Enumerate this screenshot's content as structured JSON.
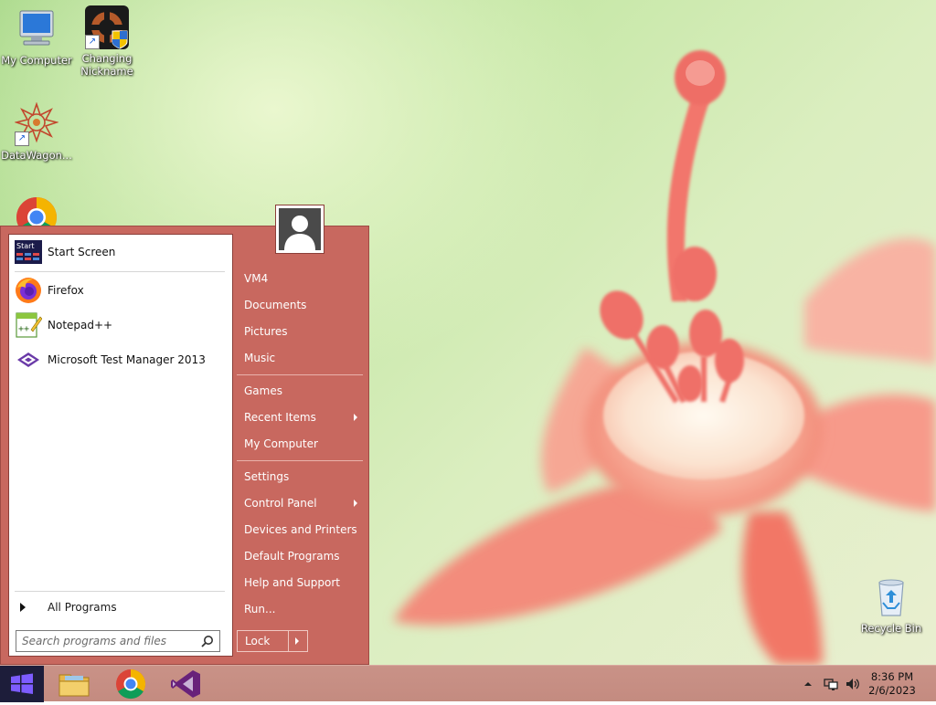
{
  "desktop": {
    "icons": [
      {
        "label": "My Computer",
        "icon": "computer-icon"
      },
      {
        "label": "Changing Nickname",
        "label_line1": "Changing",
        "label_line2": "Nickname",
        "icon": "tf2-shortcut-icon"
      },
      {
        "label": "DataWagon...",
        "icon": "datawagon-icon"
      },
      {
        "label": "",
        "icon": "chrome-icon"
      },
      {
        "label": "Recycle Bin",
        "icon": "recycle-bin-icon"
      }
    ]
  },
  "start_menu": {
    "pinned": [
      {
        "label": "Start Screen",
        "icon": "start-screen-icon"
      },
      {
        "label": "Firefox",
        "icon": "firefox-icon"
      },
      {
        "label": "Notepad++",
        "icon": "notepadpp-icon"
      },
      {
        "label": "Microsoft Test Manager 2013",
        "icon": "test-manager-icon"
      }
    ],
    "start_screen_badge": "Start",
    "all_programs": "All Programs",
    "search": {
      "placeholder": "Search programs and files",
      "value": ""
    },
    "right_items": [
      {
        "label": "VM4",
        "submenu": false
      },
      {
        "label": "Documents",
        "submenu": false
      },
      {
        "label": "Pictures",
        "submenu": false
      },
      {
        "label": "Music",
        "submenu": false
      },
      {
        "label": "Games",
        "submenu": false
      },
      {
        "label": "Recent Items",
        "submenu": true
      },
      {
        "label": "My Computer",
        "submenu": false
      },
      {
        "label": "Settings",
        "submenu": false
      },
      {
        "label": "Control Panel",
        "submenu": true
      },
      {
        "label": "Devices and Printers",
        "submenu": false
      },
      {
        "label": "Default Programs",
        "submenu": false
      },
      {
        "label": "Help and Support",
        "submenu": false
      },
      {
        "label": "Run...",
        "submenu": false
      }
    ],
    "lock_label": "Lock"
  },
  "taskbar": {
    "items": [
      {
        "name": "start",
        "icon": "windows-logo-icon"
      },
      {
        "name": "file-explorer",
        "icon": "folder-icon"
      },
      {
        "name": "chrome",
        "icon": "chrome-icon"
      },
      {
        "name": "visual-studio",
        "icon": "visual-studio-icon"
      }
    ],
    "clock": {
      "time": "8:36 PM",
      "date": "2/6/2023"
    }
  },
  "colors": {
    "menu_bg": "#c8685f",
    "taskbar_bg": "#c48b80",
    "start_button_bg": "#1d1d3a",
    "accent_blue": "#1b5fd6"
  }
}
